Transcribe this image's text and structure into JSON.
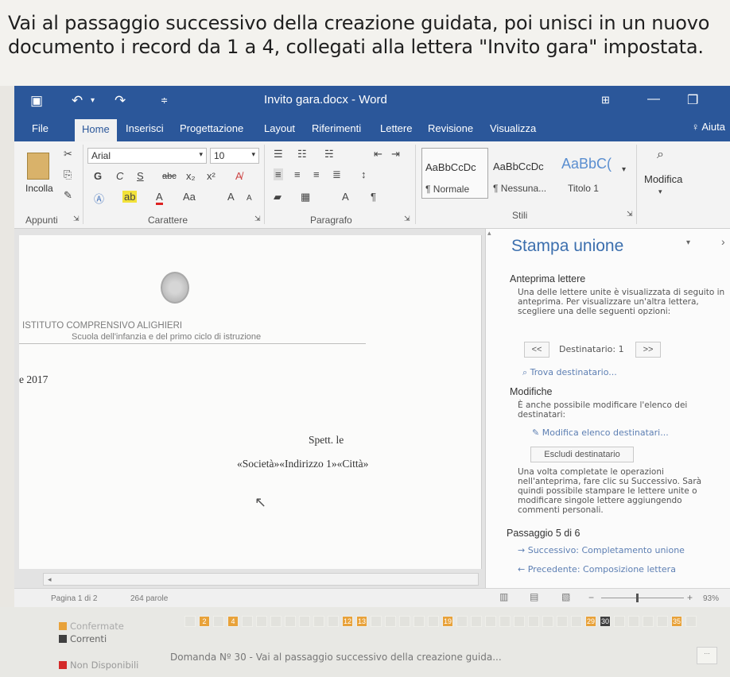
{
  "question": {
    "line1": "Vai al passaggio successivo della creazione guidata, poi unisci in un nuovo",
    "line2": "documento i record da 1 a 4, collegati alla lettera \"Invito gara\" impostata."
  },
  "titlebar": {
    "title": "Invito gara.docx - Word",
    "save_icon": "save-icon",
    "undo_icon": "undo-icon",
    "redo_icon": "redo-icon"
  },
  "tabs": [
    "File",
    "Home",
    "Inserisci",
    "Progettazione",
    "Layout",
    "Riferimenti",
    "Lettere",
    "Revisione",
    "Visualizza"
  ],
  "help": "Aiuta",
  "ribbon": {
    "paste": "Incolla",
    "font_name": "Arial",
    "font_size": "10",
    "bold": "G",
    "italic": "C",
    "underline": "S",
    "strike": "abc",
    "grow": "A",
    "shrink": "A",
    "case": "Aa",
    "sort": "A",
    "pilcrow": "¶",
    "groups": {
      "clipboard": "Appunti",
      "font": "Carattere",
      "paragraph": "Paragrafo",
      "styles": "Stili"
    },
    "styles": [
      {
        "preview": "AaBbCcDc",
        "name": "¶ Normale"
      },
      {
        "preview": "AaBbCcDc",
        "name": "¶ Nessuna..."
      },
      {
        "preview": "AaBbC(",
        "name": "Titolo 1"
      }
    ],
    "modify": "Modifica"
  },
  "document": {
    "school": "ISTITUTO COMPRENSIVO ALIGHIERI",
    "school_sub": "Scuola dell'infanzia e del primo ciclo di istruzione",
    "date_fragment": "e 2017",
    "salutation": "Spett. le",
    "fields": "«Società»«Indirizzo 1»«Città»"
  },
  "pane": {
    "title": "Stampa unione",
    "preview_heading": "Anteprima lettere",
    "preview_text": "Una delle lettere unite è visualizzata di seguito in anteprima. Per visualizzare un'altra lettera, scegliere una delle seguenti opzioni:",
    "recipient_label": "Destinatario: 1",
    "prev_btn": "<<",
    "next_btn": ">>",
    "find_recipient": "Trova destinatario...",
    "changes_heading": "Modifiche",
    "changes_text": "È anche possibile modificare l'elenco dei destinatari:",
    "edit_list": "Modifica elenco destinatari...",
    "exclude": "Escludi destinatario",
    "done_text": "Una volta completate le operazioni nell'anteprima, fare clic su Successivo. Sarà quindi possibile stampare le lettere unite o modificare singole lettere aggiungendo commenti personali.",
    "step": "Passaggio 5 di 6",
    "next_step": "Successivo: Completamento unione",
    "prev_step": "Precedente: Composizione lettera"
  },
  "status": {
    "page": "Pagina 1 di 2",
    "words": "264 parole",
    "zoom": "93%"
  },
  "legend": {
    "confirmed": "Confermate",
    "current": "Correnti",
    "unavailable": "Non Disponibili",
    "question_ref": "Domanda Nº 30 - Vai al passaggio successivo della creazione guida...",
    "cells": [
      {
        "label": "2",
        "state": "done"
      },
      {
        "label": "4",
        "state": "done"
      },
      {
        "label": "12",
        "state": "done"
      },
      {
        "label": "13",
        "state": "done"
      },
      {
        "label": "19",
        "state": "done"
      },
      {
        "label": "29",
        "state": "done"
      },
      {
        "label": "30",
        "state": "cur"
      },
      {
        "label": "35",
        "state": "done"
      }
    ]
  },
  "colors": {
    "word_blue": "#2b579a",
    "pane_title": "#3c6fae",
    "confirmed": "#e8a23a",
    "current": "#404040",
    "unavailable": "#d42a2a"
  }
}
